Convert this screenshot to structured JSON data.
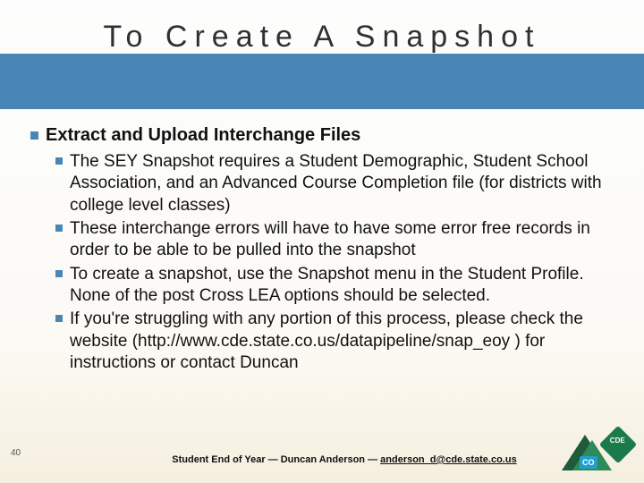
{
  "title": "To Create A Snapshot",
  "main": "Extract and Upload Interchange Files",
  "subs": [
    "The SEY Snapshot requires a Student Demographic, Student School Association, and an Advanced Course Completion file (for districts with college level classes)",
    "These interchange errors will have to have some error free records in order to be able to be pulled into the snapshot",
    "To create a snapshot, use the Snapshot menu in the Student Profile. None of the post Cross LEA options should be selected.",
    "If you're struggling with any portion of this process, please check the website (http://www.cde.state.co.us/datapipeline/snap_eoy ) for instructions or contact Duncan"
  ],
  "page_number": "40",
  "footer": {
    "prefix": "Student End of Year — Duncan Anderson — ",
    "email": "anderson_d@cde.state.co.us"
  },
  "logo": {
    "co": "CO",
    "cde": "CDE"
  }
}
